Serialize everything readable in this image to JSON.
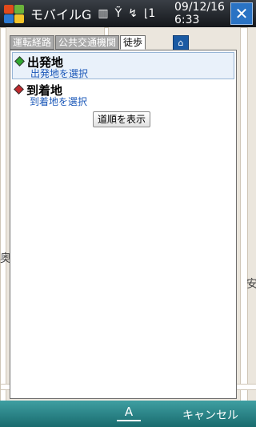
{
  "statusbar": {
    "app_title": "モバイルG",
    "time_date": "09/12/16",
    "time_clock": "6:33",
    "close_label": "✕",
    "icons": [
      "battery-icon",
      "signal-icon",
      "sync-icon",
      "antenna-icon"
    ]
  },
  "tabs": [
    {
      "label": "運転経路"
    },
    {
      "label": "公共交通機関"
    },
    {
      "label": "徒歩"
    }
  ],
  "panel": {
    "origin": {
      "title": "出発地",
      "link": "出発地を選択",
      "color": "#2fa82f"
    },
    "destination": {
      "title": "到着地",
      "link": "到着地を選択",
      "color": "#c0292d"
    },
    "route_button": "道順を表示"
  },
  "map": {
    "labels": [
      "奥",
      "安"
    ]
  },
  "softbar": {
    "sip_label": "A",
    "cancel_label": "キャンセル"
  }
}
